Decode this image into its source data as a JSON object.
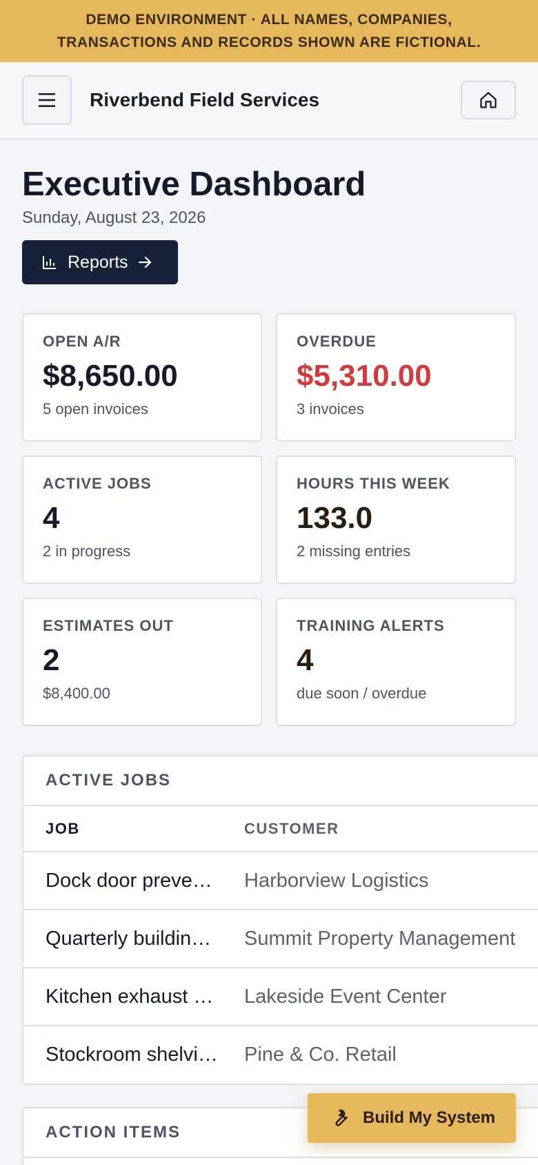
{
  "banner": {
    "line1": "DEMO ENVIRONMENT · ALL NAMES, COMPANIES,",
    "line2": "TRANSACTIONS AND RECORDS SHOWN ARE FICTIONAL."
  },
  "header": {
    "brand": "Riverbend Field Services",
    "menu_icon": "hamburger-icon",
    "home_icon": "home-icon"
  },
  "page": {
    "title": "Executive Dashboard",
    "date": "Sunday, August 23, 2026",
    "reports_label": "Reports"
  },
  "kpis": [
    {
      "label": "OPEN A/R",
      "value": "$8,650.00",
      "sub": "5 open invoices"
    },
    {
      "label": "OVERDUE",
      "value": "$5,310.00",
      "sub": "3 invoices"
    },
    {
      "label": "ACTIVE JOBS",
      "value": "4",
      "sub": "2 in progress"
    },
    {
      "label": "HOURS THIS WEEK",
      "value": "133.0",
      "sub": "2 missing entries"
    },
    {
      "label": "ESTIMATES OUT",
      "value": "2",
      "sub": "$8,400.00"
    },
    {
      "label": "TRAINING ALERTS",
      "value": "4",
      "sub": "due soon / overdue"
    }
  ],
  "active_jobs": {
    "title": "ACTIVE JOBS",
    "columns": [
      "JOB",
      "CUSTOMER"
    ],
    "rows": [
      {
        "job": "Dock door preventive maintenance",
        "customer": "Harborview Logistics"
      },
      {
        "job": "Quarterly building inspection",
        "customer": "Summit Property Management"
      },
      {
        "job": "Kitchen exhaust duct cleaning",
        "customer": "Lakeside Event Center"
      },
      {
        "job": "Stockroom shelving install",
        "customer": "Pine & Co. Retail"
      }
    ]
  },
  "action_items": {
    "title": "ACTION ITEMS"
  },
  "fab": {
    "label": "Build My System",
    "icon": "wrench-icon"
  },
  "colors": {
    "banner": "#e6b85c",
    "primary": "#17223a",
    "overdue": "#d23b3b"
  }
}
